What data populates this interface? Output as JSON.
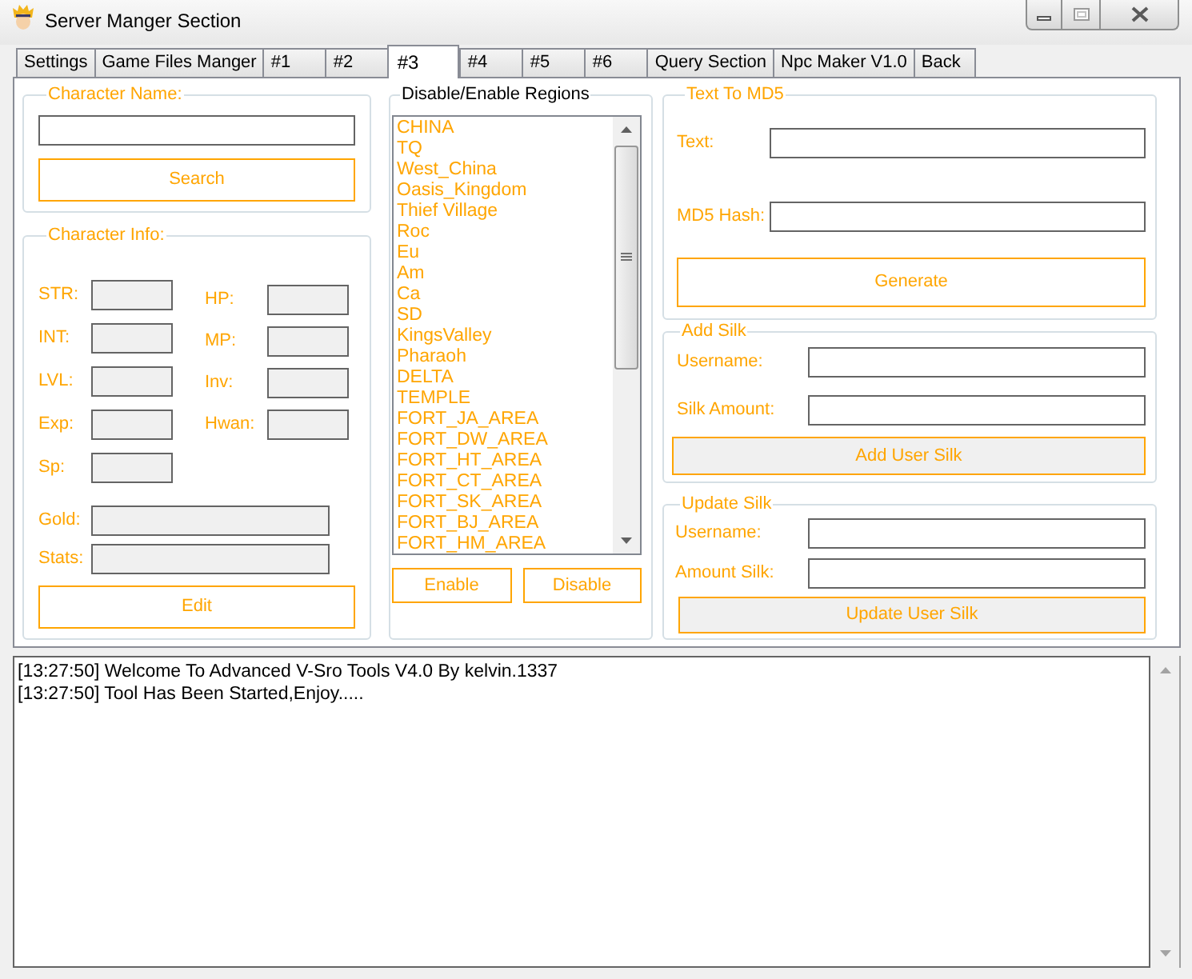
{
  "window": {
    "title": "Server Manger Section"
  },
  "tabs": [
    {
      "label": "Settings",
      "selected": false
    },
    {
      "label": "Game Files Manger",
      "selected": false
    },
    {
      "label": "#1",
      "selected": false
    },
    {
      "label": "#2",
      "selected": false
    },
    {
      "label": "#3",
      "selected": true
    },
    {
      "label": "#4",
      "selected": false
    },
    {
      "label": "#5",
      "selected": false
    },
    {
      "label": "#6",
      "selected": false
    },
    {
      "label": "Query Section",
      "selected": false
    },
    {
      "label": "Npc Maker V1.0",
      "selected": false
    },
    {
      "label": "Back",
      "selected": false
    }
  ],
  "character_name": {
    "title": "Character Name:",
    "button": "Search"
  },
  "character_info": {
    "title": "Character Info:",
    "left_fields": [
      "STR:",
      "INT:",
      "LVL:",
      "Exp:",
      "Sp:"
    ],
    "right_fields": [
      "HP:",
      "MP:",
      "Inv:",
      "Hwan:"
    ],
    "wide_fields": [
      "Gold:",
      "Stats:"
    ],
    "button": "Edit"
  },
  "regions": {
    "title": "Disable/Enable Regions",
    "items": [
      {
        "label": "CHINA",
        "selected": false
      },
      {
        "label": "TQ",
        "selected": false
      },
      {
        "label": "West_China",
        "selected": false
      },
      {
        "label": "Oasis_Kingdom",
        "selected": false
      },
      {
        "label": "Thief Village",
        "selected": false
      },
      {
        "label": "Roc",
        "selected": false
      },
      {
        "label": "Eu",
        "selected": false
      },
      {
        "label": "Am",
        "selected": false
      },
      {
        "label": "Ca",
        "selected": false
      },
      {
        "label": "SD",
        "selected": false
      },
      {
        "label": "KingsValley",
        "selected": false
      },
      {
        "label": "Pharaoh",
        "selected": false
      },
      {
        "label": "DELTA",
        "selected": false
      },
      {
        "label": "TEMPLE",
        "selected": false
      },
      {
        "label": "FORT_JA_AREA",
        "selected": false
      },
      {
        "label": "FORT_DW_AREA",
        "selected": false
      },
      {
        "label": "FORT_HT_AREA",
        "selected": false
      },
      {
        "label": "FORT_CT_AREA",
        "selected": false
      },
      {
        "label": "FORT_SK_AREA",
        "selected": false
      },
      {
        "label": "FORT_BJ_AREA",
        "selected": false
      },
      {
        "label": "FORT_HM_AREA",
        "selected": false
      }
    ],
    "buttons": [
      "Enable",
      "Disable"
    ]
  },
  "text_to_md5": {
    "title": "Text To MD5",
    "fields": [
      "Text:",
      "MD5 Hash:"
    ],
    "button": "Generate"
  },
  "add_silk": {
    "title": "Add Silk",
    "fields": [
      "Username:",
      "Silk Amount:"
    ],
    "button": "Add User Silk"
  },
  "update_silk": {
    "title": "Update Silk",
    "fields": [
      "Username:",
      "Amount Silk:"
    ],
    "button": "Update User Silk"
  },
  "log": {
    "lines": [
      "[13:27:50] Welcome To Advanced V-Sro Tools V4.0 By kelvin.1337",
      "[13:27:50] Tool Has Been Started,Enjoy....."
    ]
  }
}
